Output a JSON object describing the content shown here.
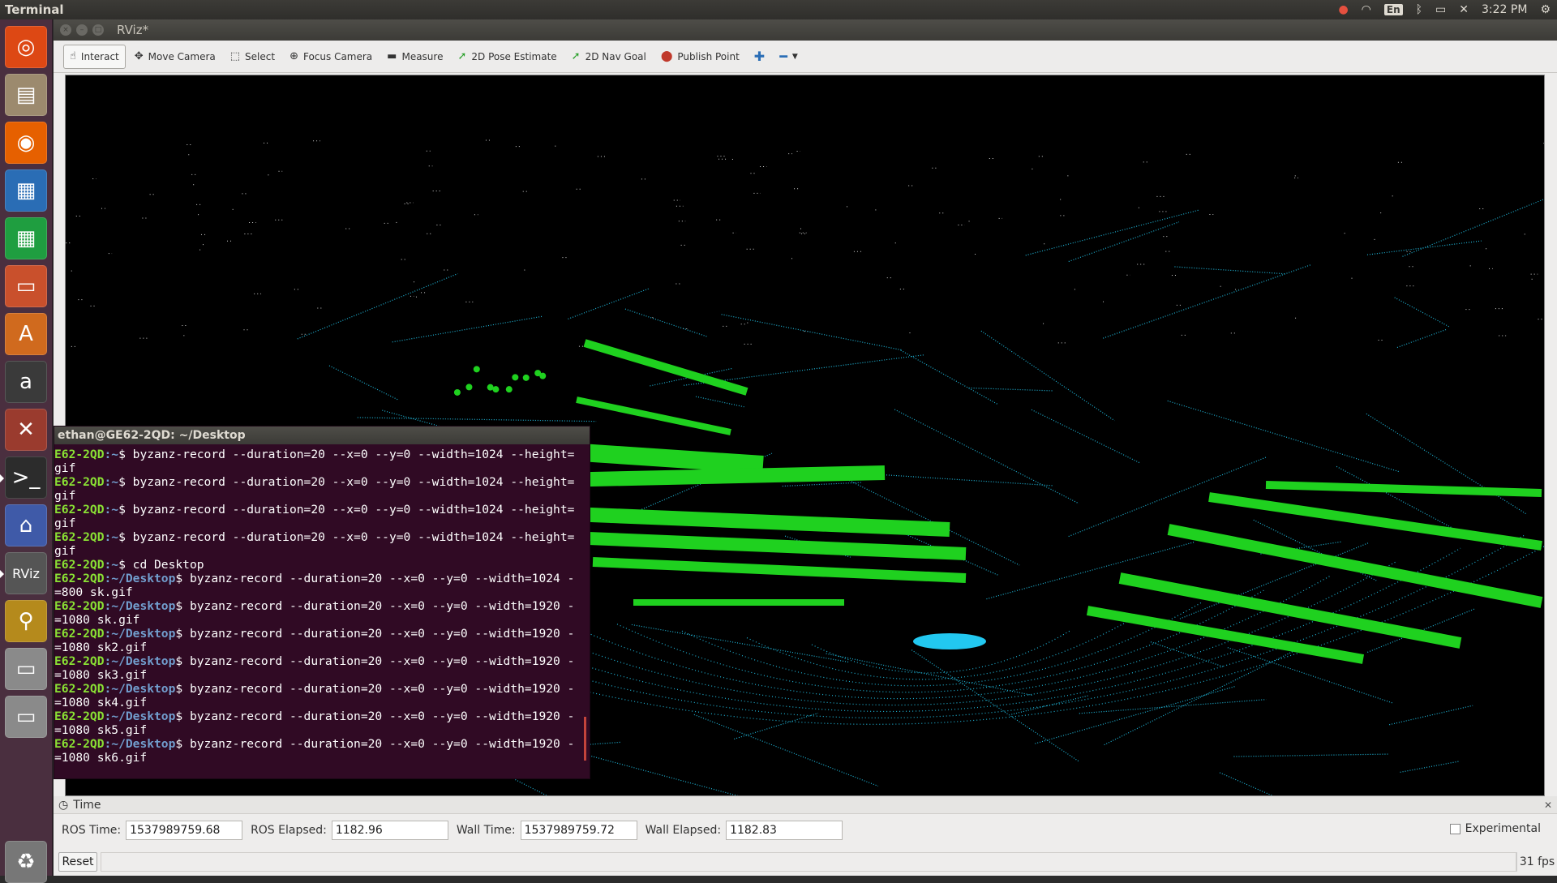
{
  "top_panel": {
    "app_title": "Terminal",
    "clock": "3:22 PM",
    "keyboard_layout": "En"
  },
  "launcher": {
    "items": [
      {
        "name": "dash",
        "glyph": "◎",
        "color": "#dd4814"
      },
      {
        "name": "files",
        "glyph": "▤",
        "color": "#9c8a6e"
      },
      {
        "name": "firefox",
        "glyph": "◉",
        "color": "#e66000"
      },
      {
        "name": "writer",
        "glyph": "▦",
        "color": "#2a6db5"
      },
      {
        "name": "calc",
        "glyph": "▦",
        "color": "#1f9e40"
      },
      {
        "name": "impress",
        "glyph": "▭",
        "color": "#c9502c"
      },
      {
        "name": "software-center",
        "glyph": "A",
        "color": "#d06a1e"
      },
      {
        "name": "amazon",
        "glyph": "a",
        "color": "#3a3a3a"
      },
      {
        "name": "settings",
        "glyph": "✕",
        "color": "#9a3b2e"
      },
      {
        "name": "terminal",
        "glyph": ">_",
        "color": "#2c2c2c"
      },
      {
        "name": "lock",
        "glyph": "⌂",
        "color": "#3f5aa8"
      },
      {
        "name": "rviz",
        "glyph": "RViz",
        "color": "#555555"
      },
      {
        "name": "image-viewer",
        "glyph": "⚲",
        "color": "#b58a1c"
      },
      {
        "name": "drive1",
        "glyph": "▭",
        "color": "#8a8a8a"
      },
      {
        "name": "drive2",
        "glyph": "▭",
        "color": "#8a8a8a"
      },
      {
        "name": "trash",
        "glyph": "♻",
        "color": "#777777"
      }
    ]
  },
  "rviz": {
    "window_title": "RViz*",
    "tools": [
      {
        "label": "Interact",
        "icon": "hand-icon",
        "glyph": "☝"
      },
      {
        "label": "Move Camera",
        "icon": "move-camera-icon",
        "glyph": "✥"
      },
      {
        "label": "Select",
        "icon": "select-icon",
        "glyph": "⬚"
      },
      {
        "label": "Focus Camera",
        "icon": "focus-camera-icon",
        "glyph": "⊕"
      },
      {
        "label": "Measure",
        "icon": "measure-icon",
        "glyph": "▬"
      },
      {
        "label": "2D Pose Estimate",
        "icon": "pose-estimate-icon",
        "glyph": "➚"
      },
      {
        "label": "2D Nav Goal",
        "icon": "nav-goal-icon",
        "glyph": "➚"
      },
      {
        "label": "Publish Point",
        "icon": "publish-point-icon",
        "glyph": "⬤"
      }
    ],
    "time_panel": {
      "title": "Time",
      "ros_time_label": "ROS Time:",
      "ros_time": "1537989759.68",
      "ros_elapsed_label": "ROS Elapsed:",
      "ros_elapsed": "1182.96",
      "wall_time_label": "Wall Time:",
      "wall_time": "1537989759.72",
      "wall_elapsed_label": "Wall Elapsed:",
      "wall_elapsed": "1182.83",
      "experimental_label": "Experimental",
      "reset_label": "Reset",
      "fps": "31 fps"
    }
  },
  "terminal": {
    "title": "ethan@GE62-2QD: ~/Desktop",
    "lines": [
      {
        "user": "E62-2QD",
        "path": ":~",
        "cmd": "$ byzanz-record --duration=20 --x=0 --y=0 --width=1024 --height=",
        "cont": "gif"
      },
      {
        "user": "E62-2QD",
        "path": ":~",
        "cmd": "$ byzanz-record --duration=20 --x=0 --y=0 --width=1024 --height=",
        "cont": "gif"
      },
      {
        "user": "E62-2QD",
        "path": ":~",
        "cmd": "$ byzanz-record --duration=20 --x=0 --y=0 --width=1024 --height=",
        "cont": "gif"
      },
      {
        "user": "E62-2QD",
        "path": ":~",
        "cmd": "$ byzanz-record --duration=20 --x=0 --y=0 --width=1024 --height=",
        "cont": "gif"
      },
      {
        "user": "E62-2QD",
        "path": ":~",
        "cmd": "$ cd Desktop",
        "cont": null
      },
      {
        "user": "E62-2QD",
        "path": ":~/Desktop",
        "cmd": "$ byzanz-record --duration=20 --x=0 --y=0 --width=1024 -",
        "cont": "=800 sk.gif"
      },
      {
        "user": "E62-2QD",
        "path": ":~/Desktop",
        "cmd": "$ byzanz-record --duration=20 --x=0 --y=0 --width=1920 -",
        "cont": "=1080 sk.gif"
      },
      {
        "user": "E62-2QD",
        "path": ":~/Desktop",
        "cmd": "$ byzanz-record --duration=20 --x=0 --y=0 --width=1920 -",
        "cont": "=1080 sk2.gif"
      },
      {
        "user": "E62-2QD",
        "path": ":~/Desktop",
        "cmd": "$ byzanz-record --duration=20 --x=0 --y=0 --width=1920 -",
        "cont": "=1080 sk3.gif"
      },
      {
        "user": "E62-2QD",
        "path": ":~/Desktop",
        "cmd": "$ byzanz-record --duration=20 --x=0 --y=0 --width=1920 -",
        "cont": "=1080 sk4.gif"
      },
      {
        "user": "E62-2QD",
        "path": ":~/Desktop",
        "cmd": "$ byzanz-record --duration=20 --x=0 --y=0 --width=1920 -",
        "cont": "=1080 sk5.gif"
      },
      {
        "user": "E62-2QD",
        "path": ":~/Desktop",
        "cmd": "$ byzanz-record --duration=20 --x=0 --y=0 --width=1920 -",
        "cont": "=1080 sk6.gif"
      }
    ]
  },
  "colors": {
    "pointcloud_ground": "#1fb4d6",
    "pointcloud_obstacles": "#1fd11f",
    "vehicle": "#22c8f0",
    "terminal_bg": "#300a24",
    "prompt_user": "#8ae234",
    "prompt_path": "#729fcf"
  }
}
